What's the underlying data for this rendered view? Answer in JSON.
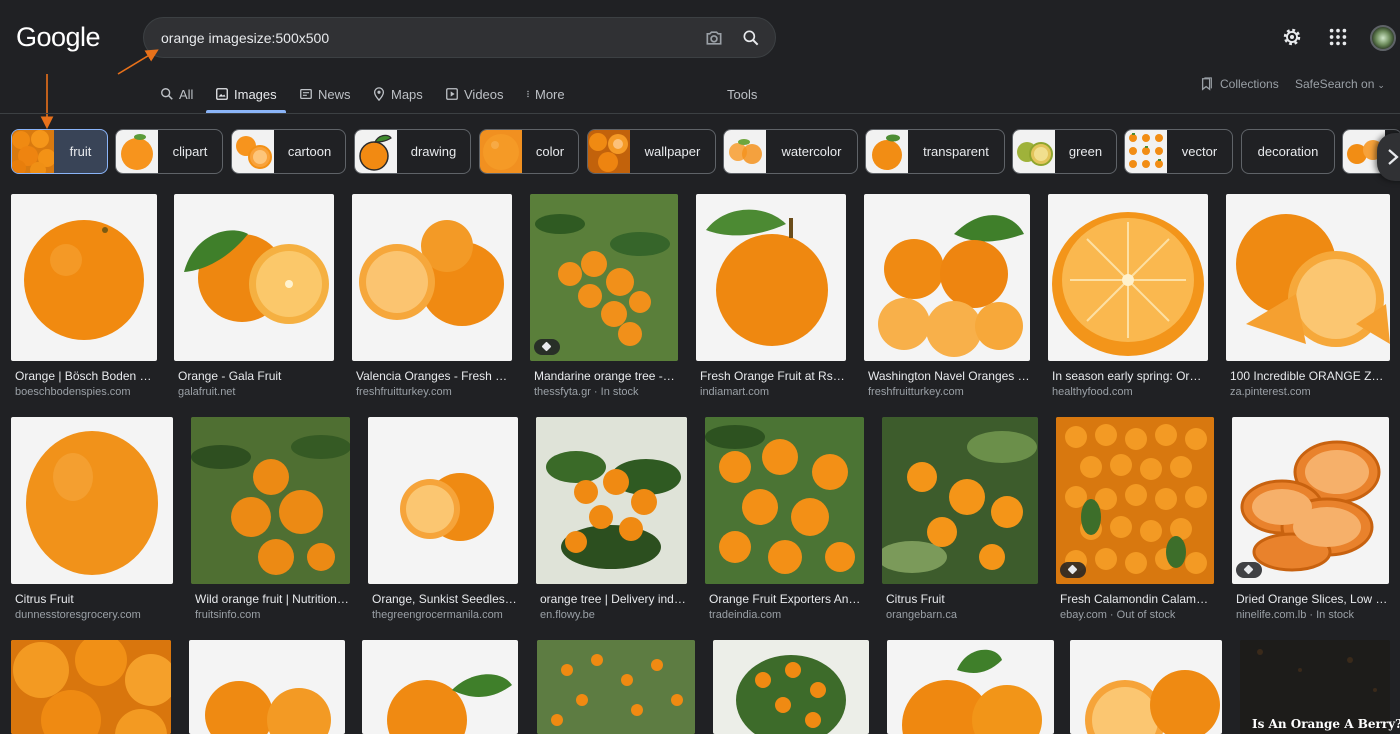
{
  "header": {
    "logo": "Google",
    "search_value": "orange imagesize:500x500",
    "settings_icon": "gear-icon",
    "apps_icon": "apps-grid-icon"
  },
  "nav": {
    "tabs": [
      {
        "label": "All",
        "icon": "search-icon"
      },
      {
        "label": "Images",
        "icon": "image-icon"
      },
      {
        "label": "News",
        "icon": "news-icon"
      },
      {
        "label": "Maps",
        "icon": "map-pin-icon"
      },
      {
        "label": "Videos",
        "icon": "play-icon"
      },
      {
        "label": "More",
        "icon": "dots-vertical-icon"
      }
    ],
    "active_tab": "Images",
    "tools": "Tools",
    "collections": "Collections",
    "safesearch": "SafeSearch on"
  },
  "chips": [
    {
      "label": "fruit",
      "selected": true
    },
    {
      "label": "clipart"
    },
    {
      "label": "cartoon"
    },
    {
      "label": "drawing"
    },
    {
      "label": "color"
    },
    {
      "label": "wallpaper"
    },
    {
      "label": "watercolor"
    },
    {
      "label": "transparent"
    },
    {
      "label": "green"
    },
    {
      "label": "vector"
    },
    {
      "label": "decoration"
    }
  ],
  "results": [
    {
      "title": "Orange | Bösch Boden Sp...",
      "source": "boeschbodenspies.com"
    },
    {
      "title": "Orange - Gala Fruit",
      "source": "galafruit.net"
    },
    {
      "title": "Valencia Oranges - Fresh Fr...",
      "source": "freshfruitturkey.com"
    },
    {
      "title": "Mandarine orange tree - P...",
      "source": "thessfyta.gr · In stock"
    },
    {
      "title": "Fresh Orange Fruit at Rs 3...",
      "source": "indiamart.com"
    },
    {
      "title": "Washington Navel Oranges - ...",
      "source": "freshfruitturkey.com"
    },
    {
      "title": "In season early spring: Oran...",
      "source": "healthyfood.com"
    },
    {
      "title": "100 Incredible ORANGE ZEST...",
      "source": "za.pinterest.com"
    },
    {
      "title": "Citrus Fruit",
      "source": "dunnesstoresgrocery.com"
    },
    {
      "title": "Wild orange fruit | Nutrition ...",
      "source": "fruitsinfo.com"
    },
    {
      "title": "Orange, Sunkist Seedless |...",
      "source": "thegreengrocermanila.com"
    },
    {
      "title": "orange tree | Delivery indo...",
      "source": "en.flowy.be"
    },
    {
      "title": "Orange Fruit Exporters And ...",
      "source": "tradeindia.com"
    },
    {
      "title": "Citrus Fruit",
      "source": "orangebarn.ca"
    },
    {
      "title": "Fresh Calamondin Calaman...",
      "source": "ebay.com · Out of stock"
    },
    {
      "title": "Dried Orange Slices, Low te...",
      "source": "ninelife.com.lb · In stock"
    }
  ],
  "row3_overlay": "Is An Orange A Berry?",
  "colors": {
    "accent": "#8ab4f8",
    "annotation_arrow": "#e8711a",
    "background": "#202124"
  }
}
